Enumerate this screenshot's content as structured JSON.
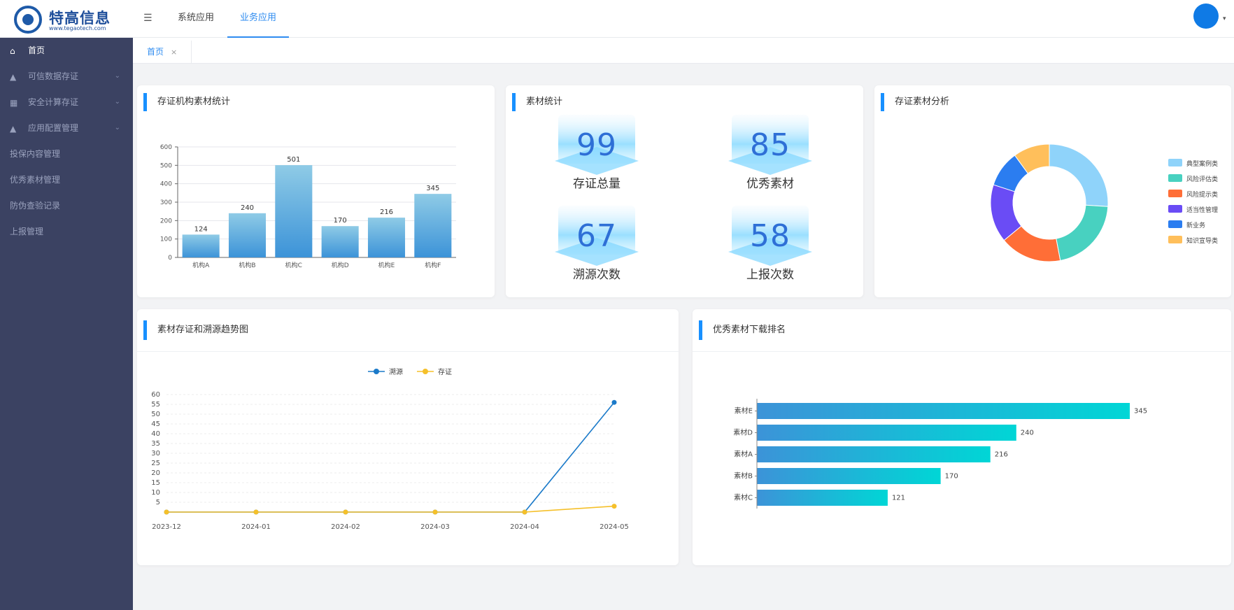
{
  "brand": {
    "name": "特高信息",
    "url": "www.tegaotech.com"
  },
  "header": {
    "tabs": [
      {
        "label": "系统应用",
        "active": false
      },
      {
        "label": "业务应用",
        "active": true
      }
    ]
  },
  "sidebar": {
    "items": [
      {
        "label": "首页",
        "icon": "home-icon",
        "active": true,
        "expandable": false
      },
      {
        "label": "可信数据存证",
        "icon": "bank-icon",
        "active": false,
        "expandable": true
      },
      {
        "label": "安全计算存证",
        "icon": "grid-icon",
        "active": false,
        "expandable": true
      },
      {
        "label": "应用配置管理",
        "icon": "bank-icon",
        "active": false,
        "expandable": true
      },
      {
        "label": "投保内容管理",
        "icon": "",
        "active": false,
        "expandable": false
      },
      {
        "label": "优秀素材管理",
        "icon": "",
        "active": false,
        "expandable": false
      },
      {
        "label": "防伪查验记录",
        "icon": "",
        "active": false,
        "expandable": false
      },
      {
        "label": "上报管理",
        "icon": "",
        "active": false,
        "expandable": false
      }
    ]
  },
  "page_tabs": [
    {
      "label": "首页",
      "close": "×"
    }
  ],
  "colors": {
    "accent": "#2f8cf0",
    "sidebar_bg": "#3b4262",
    "bar_top": "#8fcbe6",
    "bar_bottom": "#3c93d8"
  },
  "cards": {
    "org_stats": {
      "title": "存证机构素材统计"
    },
    "material_stats": {
      "title": "素材统计"
    },
    "analysis": {
      "title": "存证素材分析"
    },
    "trend": {
      "title": "素材存证和溯源趋势图"
    },
    "ranking": {
      "title": "优秀素材下载排名"
    }
  },
  "stats": [
    {
      "value": "99",
      "label": "存证总量"
    },
    {
      "value": "85",
      "label": "优秀素材"
    },
    {
      "value": "67",
      "label": "溯源次数"
    },
    {
      "value": "58",
      "label": "上报次数"
    }
  ],
  "chart_data": [
    {
      "id": "org_bar",
      "type": "bar",
      "categories": [
        "机构A",
        "机构B",
        "机构C",
        "机构D",
        "机构E",
        "机构F"
      ],
      "values": [
        124,
        240,
        501,
        170,
        216,
        345
      ],
      "ylim": [
        0,
        600
      ],
      "yticks": [
        0,
        100,
        200,
        300,
        400,
        500,
        600
      ],
      "grid": true
    },
    {
      "id": "analysis_donut",
      "type": "pie",
      "donut": true,
      "legend": "right",
      "slices": [
        {
          "name": "典型案例类",
          "value": 26,
          "color": "#8fd3fa"
        },
        {
          "name": "风险评估类",
          "value": 21,
          "color": "#48d1c0"
        },
        {
          "name": "风险提示类",
          "value": 17,
          "color": "#ff6e37"
        },
        {
          "name": "适当性管理",
          "value": 16,
          "color": "#6a4cf5"
        },
        {
          "name": "新业务",
          "value": 10,
          "color": "#2b7df0"
        },
        {
          "name": "知识宣导类",
          "value": 10,
          "color": "#ffbf5b"
        }
      ]
    },
    {
      "id": "trend_line",
      "type": "line",
      "x": [
        "2023-12",
        "2024-01",
        "2024-02",
        "2024-03",
        "2024-04",
        "2024-05"
      ],
      "series": [
        {
          "name": "溯源",
          "values": [
            0,
            0,
            0,
            0,
            0,
            56
          ],
          "color": "#1b7ac9"
        },
        {
          "name": "存证",
          "values": [
            0,
            0,
            0,
            0,
            0,
            3
          ],
          "color": "#f5c02a"
        }
      ],
      "ylim": [
        0,
        60
      ],
      "yticks": [
        5,
        10,
        15,
        20,
        25,
        30,
        35,
        40,
        45,
        50,
        55,
        60
      ],
      "legend": "top-center",
      "grid": true
    },
    {
      "id": "ranking_bar",
      "type": "bar",
      "orientation": "horizontal",
      "categories": [
        "素材E",
        "素材D",
        "素材A",
        "素材B",
        "素材C"
      ],
      "values": [
        345,
        240,
        216,
        170,
        121
      ],
      "xlim": [
        0,
        400
      ],
      "color_start": "#3c93d8",
      "color_end": "#00d6d6"
    }
  ]
}
